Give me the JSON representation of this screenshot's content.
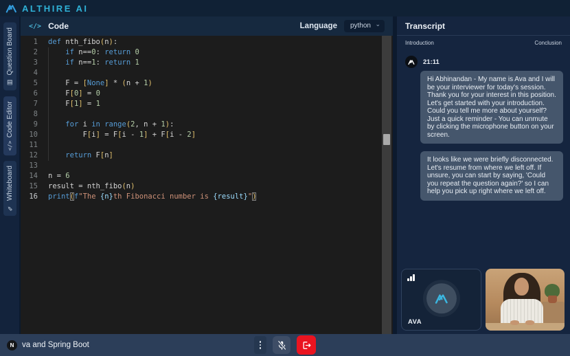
{
  "topbar": {
    "brand": "ALTHIRE AI"
  },
  "icons": {
    "code_header": "</>",
    "board": "▤",
    "code": "</>",
    "pen": "✎",
    "chevron_down": "⌄"
  },
  "sidebar": {
    "tabs": [
      {
        "label": "Question Board"
      },
      {
        "label": "Code Editor"
      },
      {
        "label": "Whiteboard"
      }
    ]
  },
  "code_panel": {
    "title": "Code",
    "language_label": "Language",
    "language_value": "python"
  },
  "editor": {
    "active_line": 16,
    "lines": [
      [
        [
          "kw",
          "def"
        ],
        [
          "txt",
          " nth_fibo"
        ],
        [
          "br",
          "("
        ],
        [
          "txt",
          "n"
        ],
        [
          "br",
          ")"
        ],
        [
          "txt",
          ":"
        ]
      ],
      [
        [
          "txt",
          "    "
        ],
        [
          "kw",
          "if"
        ],
        [
          "txt",
          " n=="
        ],
        [
          "num",
          "0"
        ],
        [
          "txt",
          ": "
        ],
        [
          "kw",
          "return"
        ],
        [
          "txt",
          " "
        ],
        [
          "num",
          "0"
        ]
      ],
      [
        [
          "txt",
          "    "
        ],
        [
          "kw",
          "if"
        ],
        [
          "txt",
          " n=="
        ],
        [
          "num",
          "1"
        ],
        [
          "txt",
          ": "
        ],
        [
          "kw",
          "return"
        ],
        [
          "txt",
          " "
        ],
        [
          "num",
          "1"
        ]
      ],
      [],
      [
        [
          "txt",
          "    F = "
        ],
        [
          "br",
          "["
        ],
        [
          "kw",
          "None"
        ],
        [
          "br",
          "]"
        ],
        [
          "txt",
          " * "
        ],
        [
          "br",
          "("
        ],
        [
          "txt",
          "n + "
        ],
        [
          "num",
          "1"
        ],
        [
          "br",
          ")"
        ]
      ],
      [
        [
          "txt",
          "    F"
        ],
        [
          "br",
          "["
        ],
        [
          "num",
          "0"
        ],
        [
          "br",
          "]"
        ],
        [
          "txt",
          " = "
        ],
        [
          "num",
          "0"
        ]
      ],
      [
        [
          "txt",
          "    F"
        ],
        [
          "br",
          "["
        ],
        [
          "num",
          "1"
        ],
        [
          "br",
          "]"
        ],
        [
          "txt",
          " = "
        ],
        [
          "num",
          "1"
        ]
      ],
      [],
      [
        [
          "txt",
          "    "
        ],
        [
          "kw",
          "for"
        ],
        [
          "txt",
          " i "
        ],
        [
          "kw",
          "in"
        ],
        [
          "txt",
          " "
        ],
        [
          "kw",
          "range"
        ],
        [
          "br",
          "("
        ],
        [
          "num",
          "2"
        ],
        [
          "txt",
          ", n + "
        ],
        [
          "num",
          "1"
        ],
        [
          "br",
          ")"
        ],
        [
          "txt",
          ":"
        ]
      ],
      [
        [
          "txt",
          "        F"
        ],
        [
          "br",
          "["
        ],
        [
          "txt",
          "i"
        ],
        [
          "br",
          "]"
        ],
        [
          "txt",
          " = F"
        ],
        [
          "br",
          "["
        ],
        [
          "txt",
          "i - "
        ],
        [
          "num",
          "1"
        ],
        [
          "br",
          "]"
        ],
        [
          "txt",
          " + F"
        ],
        [
          "br",
          "["
        ],
        [
          "txt",
          "i - "
        ],
        [
          "num",
          "2"
        ],
        [
          "br",
          "]"
        ]
      ],
      [],
      [
        [
          "txt",
          "    "
        ],
        [
          "kw",
          "return"
        ],
        [
          "txt",
          " F"
        ],
        [
          "br",
          "["
        ],
        [
          "txt",
          "n"
        ],
        [
          "br",
          "]"
        ]
      ],
      [],
      [
        [
          "txt",
          "n = "
        ],
        [
          "num",
          "6"
        ]
      ],
      [
        [
          "txt",
          "result = nth_fibo"
        ],
        [
          "br",
          "("
        ],
        [
          "txt",
          "n"
        ],
        [
          "br",
          ")"
        ]
      ],
      [
        [
          "kw",
          "print"
        ],
        [
          "br bm",
          "("
        ],
        [
          "kw",
          "f"
        ],
        [
          "str",
          "\"The "
        ],
        [
          "interp",
          "{n}"
        ],
        [
          "str",
          "th Fibonacci number is "
        ],
        [
          "interp",
          "{result}"
        ],
        [
          "str",
          "\""
        ],
        [
          "br bm",
          ")"
        ]
      ]
    ]
  },
  "transcript": {
    "title": "Transcript",
    "stage_left": "Introduction",
    "stage_right": "Conclusion",
    "messages": [
      {
        "time": "21:11",
        "text": "Hi Abhinandan - My name is Ava and I will be your interviewer for today's session. Thank you for your interest in this position. Let's get started with your introduction. Could you tell me more about yourself? Just a quick reminder - You can unmute by clicking the microphone button on your screen."
      },
      {
        "text": "It looks like we were briefly disconnected. Let's resume from where we left off. If unsure, you can start by saying, 'Could you repeat the question again?' so I can help you pick up right where we left off."
      }
    ]
  },
  "videos": {
    "ava_label": "AVA"
  },
  "bottombar": {
    "avatar_letter": "N",
    "session_title": "va and Spring Boot"
  },
  "colors": {
    "accent_cyan": "#2fb1d6",
    "danger_red": "#ea1420",
    "editor_bg": "#1c1c1c",
    "panel_navy": "#15253f",
    "bubble": "#45566c"
  }
}
